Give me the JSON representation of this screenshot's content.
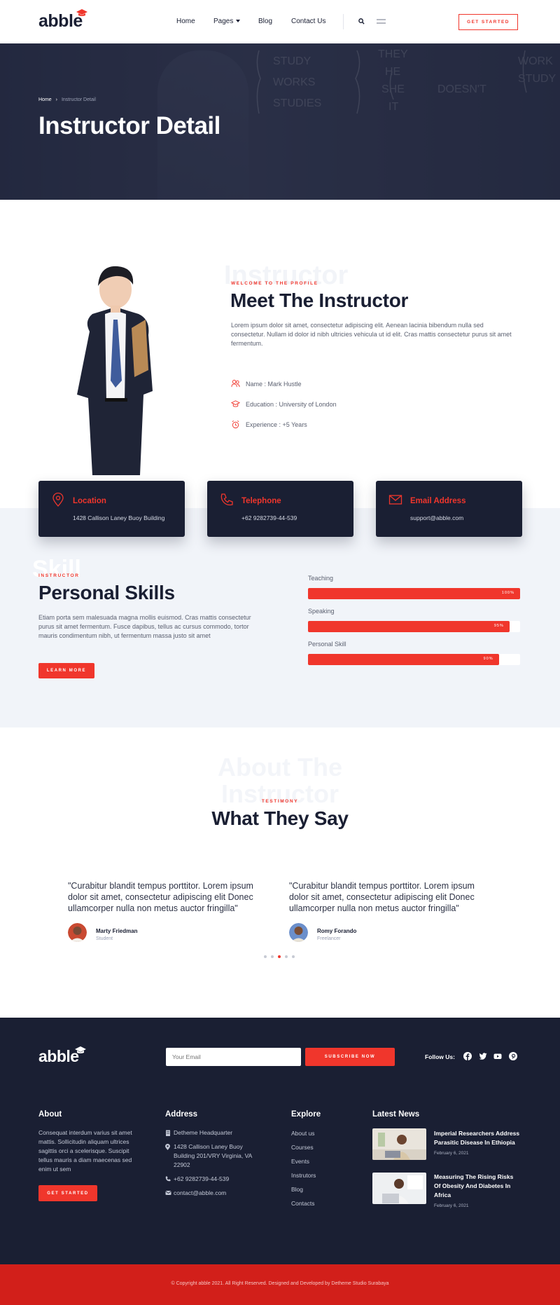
{
  "header": {
    "logo": "abble",
    "nav": [
      {
        "label": "Home"
      },
      {
        "label": "Pages"
      },
      {
        "label": "Blog"
      },
      {
        "label": "Contact Us"
      }
    ],
    "cta": "GET STARTED"
  },
  "hero": {
    "breadcrumb_home": "Home",
    "breadcrumb_current": "Instructor Detail",
    "title": "Instructor Detail"
  },
  "profile": {
    "ghost": "Instructor",
    "eyebrow": "WELCOME TO THE PROFILE",
    "title": "Meet The Instructor",
    "text": "Lorem ipsum dolor sit amet, consectetur adipiscing elit. Aenean lacinia bibendum nulla sed consectetur. Nullam id dolor id nibh ultricies vehicula ut id elit. Cras mattis consectetur purus sit amet fermentum.",
    "info": [
      {
        "label": "Name : Mark Hustle",
        "icon": "users-icon"
      },
      {
        "label": "Education : University of London",
        "icon": "graduation-cap-icon"
      },
      {
        "label": "Experience : +5 Years",
        "icon": "alarm-clock-icon"
      }
    ]
  },
  "contact_cards": [
    {
      "title": "Location",
      "value": "1428 Callison Laney Buoy Building",
      "icon": "map-pin-icon"
    },
    {
      "title": "Telephone",
      "value": "+62 9282739-44-539",
      "icon": "phone-icon"
    },
    {
      "title": "Email Address",
      "value": "support@abble.com",
      "icon": "envelope-icon"
    }
  ],
  "skills": {
    "ghost": "Skill",
    "eyebrow": "INSTRUCTOR",
    "title": "Personal Skills",
    "text": "Etiam porta sem malesuada magna mollis euismod. Cras mattis consectetur purus sit amet fermentum. Fusce dapibus, tellus ac cursus commodo, tortor mauris condimentum nibh, ut fermentum massa justo sit amet",
    "button": "LEARN MORE",
    "bars": [
      {
        "label": "Teaching",
        "value": 100,
        "text": "100%"
      },
      {
        "label": "Speaking",
        "value": 95,
        "text": "95%"
      },
      {
        "label": "Personal Skill",
        "value": 90,
        "text": "90%"
      }
    ]
  },
  "testimonials": {
    "ghost_line1": "About The",
    "ghost_line2": "Instructor",
    "eyebrow": "TESTIMONY",
    "title": "What They Say",
    "items": [
      {
        "quote": "\"Curabitur blandit tempus porttitor. Lorem ipsum dolor sit amet, consectetur adipiscing elit Donec ullamcorper nulla non metus auctor fringilla\"",
        "name": "Marty Friedman",
        "role": "Student"
      },
      {
        "quote": "\"Curabitur blandit tempus porttitor. Lorem ipsum dolor sit amet, consectetur adipiscing elit Donec ullamcorper nulla non metus auctor fringilla\"",
        "name": "Romy Forando",
        "role": "Freelancer"
      }
    ],
    "active_dot": 2
  },
  "footer": {
    "logo": "abble",
    "email_placeholder": "Your Email",
    "subscribe": "SUBSCRIBE NOW",
    "follow": "Follow Us:",
    "about_title": "About",
    "about_text": "Consequat interdum varius sit amet mattis. Sollicitudin aliquam ultrices sagittis orci a scelerisque. Suscipit tellus mauris a diam maecenas sed enim ut sem",
    "about_button": "GET STARTED",
    "address_title": "Address",
    "address": [
      {
        "text": "Detheme Headquarter",
        "icon": "building-icon"
      },
      {
        "text": "1428 Callison Laney Buoy Building 201/VRY Virginia, VA 22902",
        "icon": "map-pin-icon"
      },
      {
        "text": "+62 9282739-44-539",
        "icon": "phone-icon"
      },
      {
        "text": "contact@abble.com",
        "icon": "mail-icon"
      }
    ],
    "explore_title": "Explore",
    "explore": [
      "About us",
      "Courses",
      "Events",
      "Instrutors",
      "Blog",
      "Contacts"
    ],
    "news_title": "Latest News",
    "news": [
      {
        "title": "Imperial Researchers Address Parasitic Disease In Ethiopia",
        "date": "February 6, 2021"
      },
      {
        "title": "Measuring The Rising Risks Of Obesity And Diabetes In Africa",
        "date": "February 6, 2021"
      }
    ],
    "copyright": "© Copyright abble 2021. All Right Reserved. Designed and Developed by Detheme Studio Surabaya"
  },
  "colors": {
    "accent": "#f0362c",
    "navy": "#1a1f33",
    "light_bg": "#f1f4f9"
  }
}
